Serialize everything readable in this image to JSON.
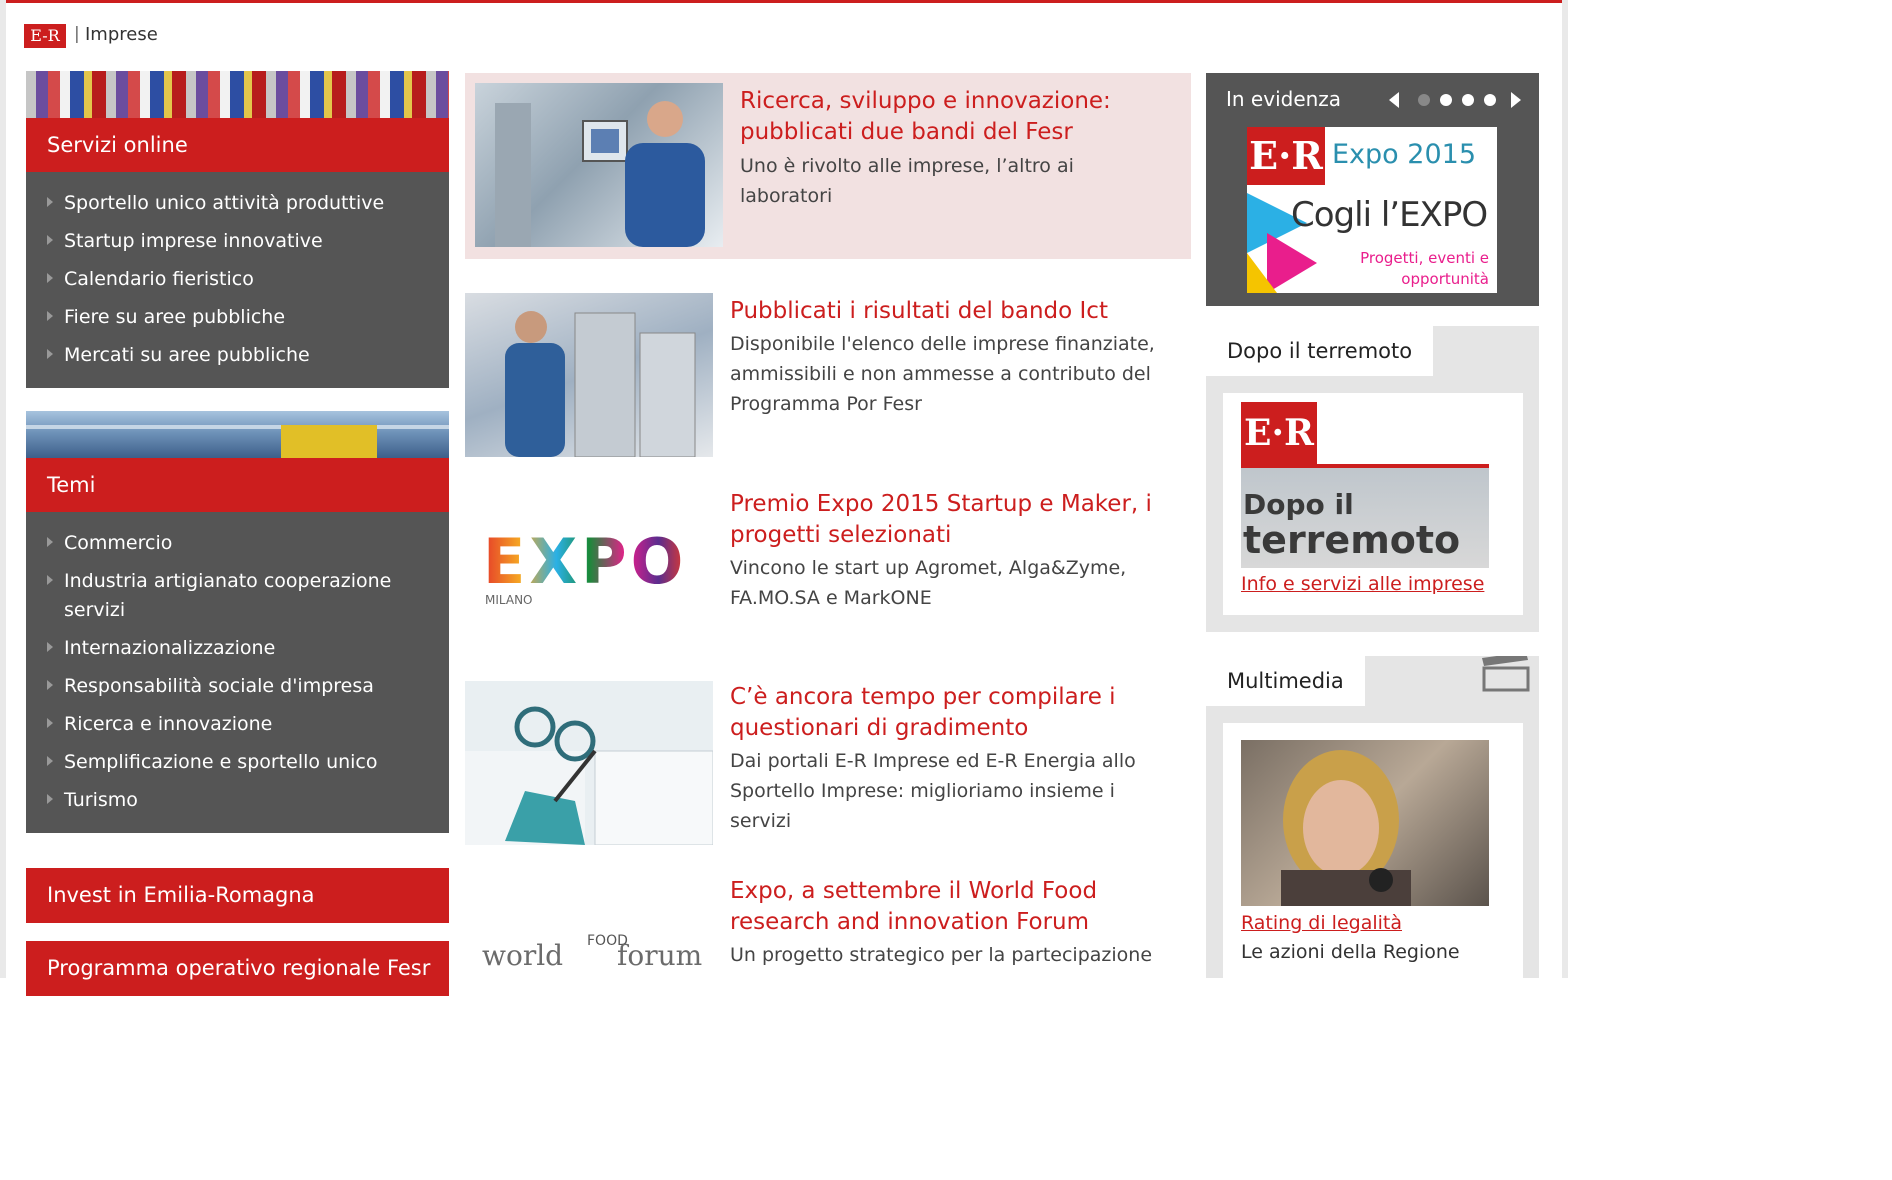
{
  "header": {
    "logo_text": "E-R",
    "separator": "|",
    "site_name": "Imprese"
  },
  "left": {
    "servizi": {
      "title": "Servizi online",
      "items": [
        "Sportello unico attività produttive",
        "Startup imprese innovative",
        "Calendario fieristico",
        "Fiere su aree pubbliche",
        "Mercati su aree pubbliche"
      ]
    },
    "temi": {
      "title": "Temi",
      "items": [
        "Commercio",
        "Industria artigianato cooperazione servizi",
        "Internazionalizzazione",
        "Responsabilità sociale d'impresa",
        "Ricerca e innovazione",
        "Semplificazione e sportello unico",
        "Turismo"
      ]
    },
    "invest": "Invest in Emilia-Romagna",
    "programma": "Programma operativo regionale Fesr"
  },
  "news": [
    {
      "title": "Ricerca, sviluppo e innovazione: pubblicati due bandi del Fesr",
      "summary": "Uno è rivolto alle imprese, l’altro ai laboratori"
    },
    {
      "title": "Pubblicati i risultati del bando Ict",
      "summary": "Disponibile l'elenco delle imprese finanziate, ammissibili e non ammesse a contributo del Programma Por Fesr"
    },
    {
      "title": "Premio Expo 2015 Startup e Maker, i progetti selezionati",
      "summary": "Vincono le start up Agromet, Alga&Zyme, FA.MO.SA e MarkONE",
      "image_text": "EXPO",
      "image_caption": "MILANO"
    },
    {
      "title": "C’è ancora tempo per compilare i questionari di gradimento",
      "summary": "Dai portali E-R Imprese ed E-R Energia allo Sportello Imprese: miglioriamo insieme i servizi"
    },
    {
      "title": "Expo, a settembre il World Food research and innovation Forum",
      "summary": "Un progetto strategico per la partecipazione",
      "image_left": "world",
      "image_food": "FOOD",
      "image_right": "forum"
    }
  ],
  "right": {
    "evidenza": {
      "title": "In evidenza",
      "banner_logo": "E·R",
      "banner_expo": "Expo 2015",
      "banner_cogli": "Cogli l’EXPO",
      "banner_sub1": "Progetti, eventi e",
      "banner_sub2": "opportunità",
      "active_dot": 1
    },
    "terremoto": {
      "title": "Dopo il terremoto",
      "image_logo": "E·R",
      "image_line1": "Dopo il",
      "image_line2": "terremoto",
      "link": "Info e servizi alle imprese"
    },
    "multimedia": {
      "title": "Multimedia",
      "link": "Rating di legalità",
      "caption": "Le azioni della Regione"
    }
  },
  "colors": {
    "brand_red": "#cc1e1e",
    "menu_grey": "#555555",
    "featured_bg": "#f2e1e1",
    "sidebar_bg": "#e5e5e5"
  }
}
